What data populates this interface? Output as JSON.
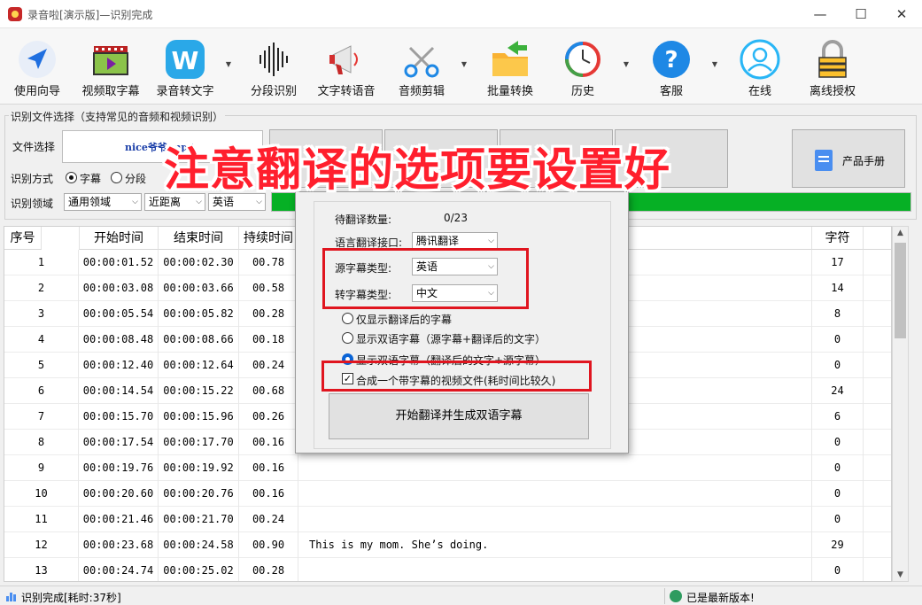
{
  "window": {
    "title": "录音啦[演示版]—识别完成",
    "min": "—",
    "max": "☐",
    "close": "✕"
  },
  "toolbar": [
    {
      "label": "使用向导",
      "icon": "navigation-arrow-icon"
    },
    {
      "label": "视频取字幕",
      "icon": "film-play-icon"
    },
    {
      "label": "录音转文字",
      "icon": "w-app-icon"
    },
    {
      "label": "分段识别",
      "icon": "sound-wave-icon"
    },
    {
      "label": "文字转语音",
      "icon": "megaphone-icon"
    },
    {
      "label": "音频剪辑",
      "icon": "scissors-icon"
    },
    {
      "label": "批量转换",
      "icon": "folder-arrow-icon"
    },
    {
      "label": "历史",
      "icon": "history-clock-icon"
    },
    {
      "label": "客服",
      "icon": "question-icon"
    },
    {
      "label": "在线",
      "icon": "user-online-icon"
    },
    {
      "label": "离线授权",
      "icon": "lock-icon"
    }
  ],
  "file_group": {
    "title": "识别文件选择（支持常见的音频和视频识别）",
    "file_label": "文件选择",
    "file_name": "nice爷爷.mp4",
    "mode_label": "识别方式",
    "mode_subtitle": "字幕",
    "mode_segment": "分段",
    "domain_label": "识别领域",
    "domain_value": "通用领域",
    "distance_value": "近距离",
    "language_value": "英语",
    "manual_button": "产品手册",
    "progress_percent": 100
  },
  "table": {
    "headers": [
      "序号",
      "开始时间",
      "结束时间",
      "持续时间",
      "字符"
    ],
    "rows": [
      {
        "no": "1",
        "start": "00:00:01.52",
        "end": "00:00:02.30",
        "dur": "00.78",
        "text": "",
        "chars": "17"
      },
      {
        "no": "2",
        "start": "00:00:03.08",
        "end": "00:00:03.66",
        "dur": "00.58",
        "text": "",
        "chars": "14"
      },
      {
        "no": "3",
        "start": "00:00:05.54",
        "end": "00:00:05.82",
        "dur": "00.28",
        "text": "",
        "chars": "8"
      },
      {
        "no": "4",
        "start": "00:00:08.48",
        "end": "00:00:08.66",
        "dur": "00.18",
        "text": "",
        "chars": "0"
      },
      {
        "no": "5",
        "start": "00:00:12.40",
        "end": "00:00:12.64",
        "dur": "00.24",
        "text": "",
        "chars": "0"
      },
      {
        "no": "6",
        "start": "00:00:14.54",
        "end": "00:00:15.22",
        "dur": "00.68",
        "text": "",
        "chars": "24"
      },
      {
        "no": "7",
        "start": "00:00:15.70",
        "end": "00:00:15.96",
        "dur": "00.26",
        "text": "",
        "chars": "6"
      },
      {
        "no": "8",
        "start": "00:00:17.54",
        "end": "00:00:17.70",
        "dur": "00.16",
        "text": "",
        "chars": "0"
      },
      {
        "no": "9",
        "start": "00:00:19.76",
        "end": "00:00:19.92",
        "dur": "00.16",
        "text": "",
        "chars": "0"
      },
      {
        "no": "10",
        "start": "00:00:20.60",
        "end": "00:00:20.76",
        "dur": "00.16",
        "text": "",
        "chars": "0"
      },
      {
        "no": "11",
        "start": "00:00:21.46",
        "end": "00:00:21.70",
        "dur": "00.24",
        "text": "",
        "chars": "0"
      },
      {
        "no": "12",
        "start": "00:00:23.68",
        "end": "00:00:24.58",
        "dur": "00.90",
        "text": "This is my mom. She’s doing.",
        "chars": "29"
      },
      {
        "no": "13",
        "start": "00:00:24.74",
        "end": "00:00:25.02",
        "dur": "00.28",
        "text": "",
        "chars": "0"
      }
    ]
  },
  "status": {
    "left": "识别完成[耗时:37秒]",
    "right": "已是最新版本!"
  },
  "dialog": {
    "pending_label": "待翻译数量:",
    "pending_value": "0/23",
    "api_label": "语言翻译接口:",
    "api_value": "腾讯翻译",
    "source_label": "源字幕类型:",
    "source_value": "英语",
    "target_label": "转字幕类型:",
    "target_value": "中文",
    "option1": "仅显示翻译后的字幕",
    "option2": "显示双语字幕（源字幕+翻译后的文字）",
    "option3": "显示双语字幕（翻译后的文字+源字幕）",
    "merge_label": "合成一个带字幕的视频文件(耗时间比较久)",
    "start_button": "开始翻译并生成双语字幕"
  },
  "overlay": {
    "caption": "注意翻译的选项要设置好"
  },
  "colors": {
    "accent_red": "#e0151f",
    "progress_green": "#06b025",
    "caption_red": "#ff1f2d"
  }
}
